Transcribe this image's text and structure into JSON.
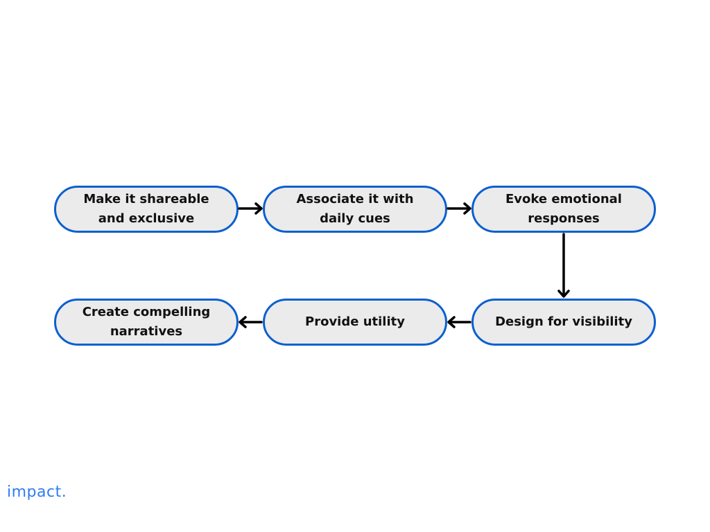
{
  "nodes": [
    {
      "id": "n1",
      "label": "Make it shareable and exclusive"
    },
    {
      "id": "n2",
      "label": "Associate it with daily cues"
    },
    {
      "id": "n3",
      "label": "Evoke emotional responses"
    },
    {
      "id": "n4",
      "label": "Design for visibility"
    },
    {
      "id": "n5",
      "label": "Provide utility"
    },
    {
      "id": "n6",
      "label": "Create compelling narratives"
    }
  ],
  "edges": [
    {
      "from": "n1",
      "to": "n2"
    },
    {
      "from": "n2",
      "to": "n3"
    },
    {
      "from": "n3",
      "to": "n4"
    },
    {
      "from": "n4",
      "to": "n5"
    },
    {
      "from": "n5",
      "to": "n6"
    }
  ],
  "colors": {
    "border": "#0b5fcf",
    "fill": "#ebebeb",
    "logo": "#2f7cf6"
  },
  "logo": {
    "text": "impact."
  }
}
